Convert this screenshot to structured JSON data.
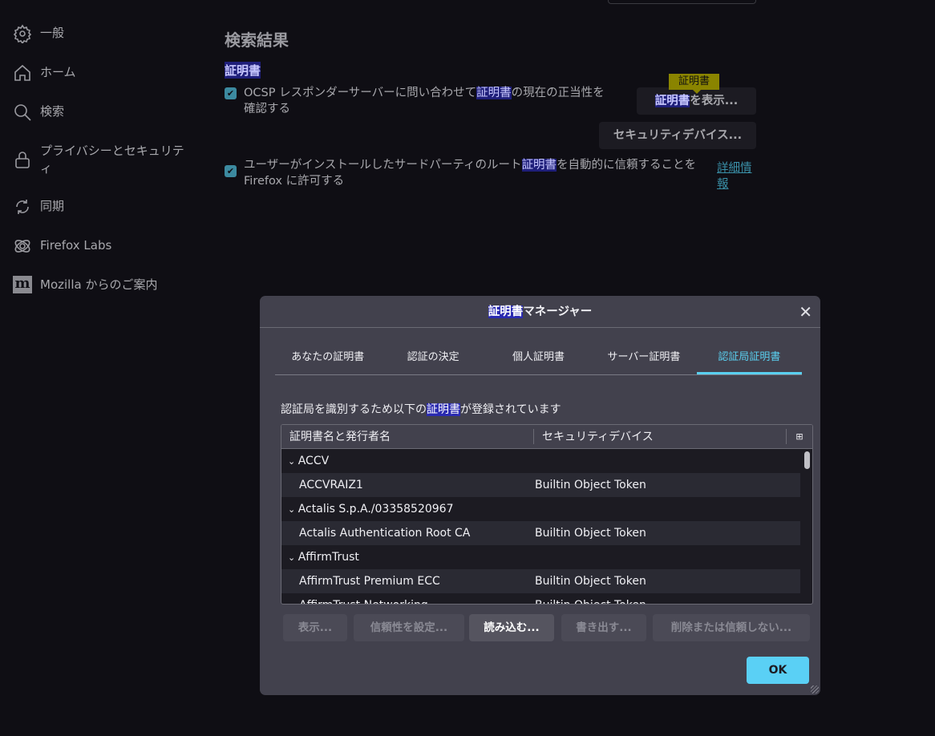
{
  "sidebar": {
    "items": [
      {
        "label": "一般",
        "icon": "gear-icon"
      },
      {
        "label": "ホーム",
        "icon": "home-icon"
      },
      {
        "label": "検索",
        "icon": "search-icon"
      },
      {
        "label": "プライバシーとセキュリティ",
        "icon": "lock-icon"
      },
      {
        "label": "同期",
        "icon": "sync-icon"
      },
      {
        "label": "Firefox Labs",
        "icon": "labs-icon"
      },
      {
        "label": "Mozilla からのご案内",
        "icon": "mozilla-icon"
      }
    ],
    "mozilla_glyph": "m"
  },
  "main": {
    "title": "検索結果",
    "section": "証明書",
    "ocsp": {
      "pre": "OCSP レスポンダーサーバーに問い合わせて",
      "hl": "証明書",
      "post": "の現在の正当性を確認する",
      "checked": true
    },
    "thirdparty": {
      "pre": "ユーザーがインストールしたサードパーティのルート",
      "hl": "証明書",
      "post": "を自動的に信頼することを Firefox に許可する",
      "checked": true
    },
    "view_hl": "証明書",
    "view_rest": "を表示...",
    "security_devices": "セキュリティデバイス...",
    "tooltip": "証明書",
    "learn_more": "詳細情報"
  },
  "dialog": {
    "title_hl": "証明書",
    "title_rest": "マネージャー",
    "close": "✕",
    "tabs": [
      "あなたの証明書",
      "認証の決定",
      "個人証明書",
      "サーバー証明書",
      "認証局証明書"
    ],
    "active_tab": 4,
    "desc_pre": "認証局を識別するため以下の",
    "desc_hl": "証明書",
    "desc_post": "が登録されています",
    "columns": [
      "証明書名と発行者名",
      "セキュリティデバイス"
    ],
    "column_picker": "⊞",
    "rows": [
      {
        "name": "ACCV",
        "device": "",
        "group": true
      },
      {
        "name": "ACCVRAIZ1",
        "device": "Builtin Object Token"
      },
      {
        "name": "Actalis S.p.A./03358520967",
        "device": "",
        "group": true
      },
      {
        "name": "Actalis Authentication Root CA",
        "device": "Builtin Object Token"
      },
      {
        "name": "AffirmTrust",
        "device": "",
        "group": true
      },
      {
        "name": "AffirmTrust Premium ECC",
        "device": "Builtin Object Token"
      },
      {
        "name": "AffirmTrust Networking",
        "device": "Builtin Object Token"
      }
    ],
    "buttons": {
      "view": "表示...",
      "trust": "信頼性を設定...",
      "import": "読み込む...",
      "export": "書き出す...",
      "delete": "削除または信頼しない..."
    },
    "ok": "OK"
  }
}
